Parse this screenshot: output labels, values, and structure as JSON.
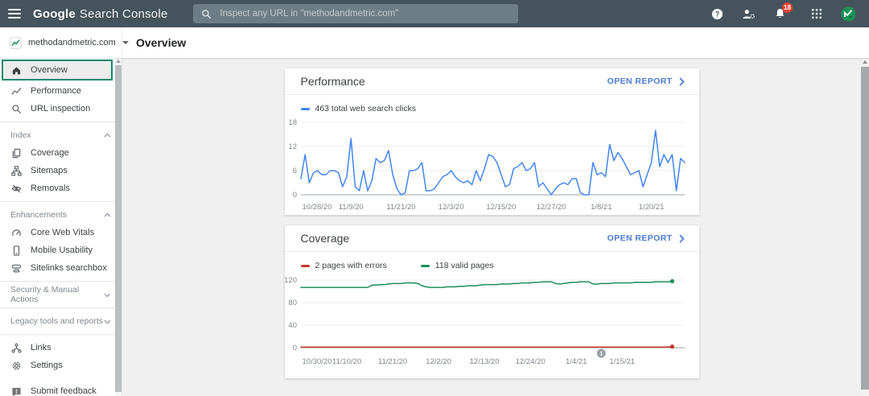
{
  "header": {
    "brand_google": "Google",
    "brand_product": "Search Console",
    "search_placeholder": "Inspect any URL in \"methodandmetric.com\"",
    "notification_badge": "18"
  },
  "property_bar": {
    "property_name": "methodandmetric.com",
    "page_title": "Overview"
  },
  "sidebar": {
    "overview": "Overview",
    "performance": "Performance",
    "url_inspection": "URL inspection",
    "section_index": "Index",
    "coverage": "Coverage",
    "sitemaps": "Sitemaps",
    "removals": "Removals",
    "section_enhancements": "Enhancements",
    "core_web_vitals": "Core Web Vitals",
    "mobile_usability": "Mobile Usability",
    "sitelinks_searchbox": "Sitelinks searchbox",
    "section_security": "Security & Manual Actions",
    "section_legacy": "Legacy tools and reports",
    "links": "Links",
    "settings": "Settings",
    "submit_feedback": "Submit feedback"
  },
  "cards": {
    "performance": {
      "title": "Performance",
      "open_report": "OPEN REPORT",
      "legend": "463 total web search clicks"
    },
    "coverage": {
      "title": "Coverage",
      "open_report": "OPEN REPORT",
      "legend_errors": "2 pages with errors",
      "legend_valid": "118 valid pages"
    }
  },
  "icons": {
    "menu": "hamburger-3-lines",
    "search": "magnifier",
    "help": "white circle with ?",
    "manage_users": "person with gear",
    "notifications": "bell with red badge",
    "google_apps": "3x3 dot grid",
    "account_avatar": "green circle with search-console mark",
    "property_mark": "white square with green zigzag",
    "overview": "home",
    "performance": "line-chart",
    "url_inspection": "magnifier",
    "coverage": "stacked pages",
    "sitemaps": "tree",
    "removals": "eye-off",
    "core_web_vitals": "speedometer",
    "mobile_usability": "smartphone",
    "sitelinks_searchbox": "search box rows",
    "links": "node graph",
    "settings": "gear",
    "submit_feedback": "feedback square with !"
  },
  "colors": {
    "topbar": "#45545c",
    "accent_blue": "#4285f4",
    "link_blue": "#4a7bd8",
    "valid_green": "#1e8e5a",
    "error_red": "#c5352c",
    "selected_outline": "#0e8a6d",
    "badge_red": "#ea4335"
  },
  "chart_data": [
    {
      "type": "line",
      "title": "Performance: total web search clicks per day",
      "x_tick_labels": [
        "10/28/20",
        "11/9/20",
        "11/21/20",
        "12/3/20",
        "12/15/20",
        "12/27/20",
        "1/8/21",
        "1/20/21"
      ],
      "x_tick_day_indices": [
        0,
        12,
        24,
        36,
        48,
        60,
        72,
        84
      ],
      "x_span_days": 92,
      "ylim": [
        0,
        18
      ],
      "y_ticks": [
        0,
        6,
        12,
        18
      ],
      "grid": true,
      "legend_position": "top-left",
      "series": [
        {
          "name": "463 total web search clicks",
          "color": "#4285f4",
          "end_dot": false,
          "values": [
            4,
            10,
            3,
            5.5,
            6,
            5,
            5,
            6,
            6,
            5.5,
            2,
            4.5,
            14,
            2,
            1,
            6,
            1,
            3.5,
            9,
            8,
            8.5,
            11,
            5,
            1.5,
            0,
            0.5,
            6,
            6,
            6.5,
            8,
            1,
            1,
            1.5,
            3,
            4.5,
            5,
            6,
            4.5,
            3.5,
            3,
            3.5,
            2.5,
            6,
            3.5,
            6.5,
            10,
            9.5,
            8,
            5,
            2,
            2.5,
            6.5,
            7,
            8,
            6,
            6.5,
            8,
            2,
            3,
            1.5,
            0,
            1.5,
            2.5,
            3,
            2.5,
            4,
            4,
            0.5,
            0,
            0,
            8,
            5,
            5.5,
            4.5,
            12.5,
            8.5,
            10.5,
            9,
            7,
            5,
            5.5,
            6,
            2,
            5,
            8,
            16,
            7,
            10,
            8,
            10,
            1,
            9,
            8
          ]
        }
      ]
    },
    {
      "type": "line",
      "title": "Coverage: indexed pages per day",
      "x_tick_labels": [
        "10/30/20",
        "11/10/20",
        "11/21/20",
        "12/2/20",
        "12/13/20",
        "12/24/20",
        "1/4/21",
        "1/15/21"
      ],
      "x_tick_day_indices": [
        0,
        11,
        22,
        33,
        44,
        55,
        66,
        77
      ],
      "x_span_days": 92,
      "ylim": [
        0,
        120
      ],
      "y_ticks": [
        0,
        40,
        80,
        120
      ],
      "grid": true,
      "legend_position": "top-left",
      "annotation": {
        "label": "1",
        "day_index": 72
      },
      "series": [
        {
          "name": "2 pages with errors",
          "color": "#c5352c",
          "end_dot": true,
          "values": [
            1,
            1,
            1,
            1,
            1,
            1,
            1,
            1,
            1,
            1,
            1,
            1,
            1,
            1,
            1,
            1,
            1,
            1,
            1,
            1,
            1,
            1,
            1,
            1,
            1,
            1,
            1,
            1,
            1,
            1,
            1,
            1,
            1,
            1,
            1,
            1,
            1,
            1,
            1,
            1,
            1,
            1,
            1,
            1,
            1,
            1,
            1,
            1,
            1,
            1,
            1,
            1,
            1,
            1,
            1,
            1,
            1,
            1,
            1,
            1,
            1,
            1,
            1,
            1,
            1,
            1,
            1,
            1,
            1,
            1,
            1,
            1,
            1,
            1,
            1,
            1,
            1,
            1,
            1,
            1,
            1,
            1,
            1,
            1,
            1,
            1,
            1,
            1,
            1.5,
            2
          ]
        },
        {
          "name": "118 valid pages",
          "color": "#1e8e5a",
          "end_dot": true,
          "values": [
            107,
            107,
            107,
            107,
            107,
            107,
            107,
            107,
            107,
            107,
            107,
            107,
            107,
            107,
            107,
            107,
            107,
            111,
            111,
            112,
            112,
            113,
            114,
            114,
            114,
            115,
            115,
            115,
            114,
            110,
            108,
            107,
            107,
            107,
            107,
            108,
            108,
            108,
            109,
            109,
            110,
            110,
            110,
            111,
            112,
            112,
            112,
            112,
            113,
            113,
            113,
            114,
            114,
            115,
            115,
            115,
            116,
            116,
            117,
            117,
            117,
            114,
            113,
            114,
            115,
            116,
            116,
            117,
            117,
            117,
            113,
            113,
            114,
            114,
            114,
            115,
            115,
            115,
            115,
            115,
            116,
            116,
            116,
            116,
            116,
            117,
            117,
            117,
            117,
            118
          ]
        }
      ]
    }
  ]
}
